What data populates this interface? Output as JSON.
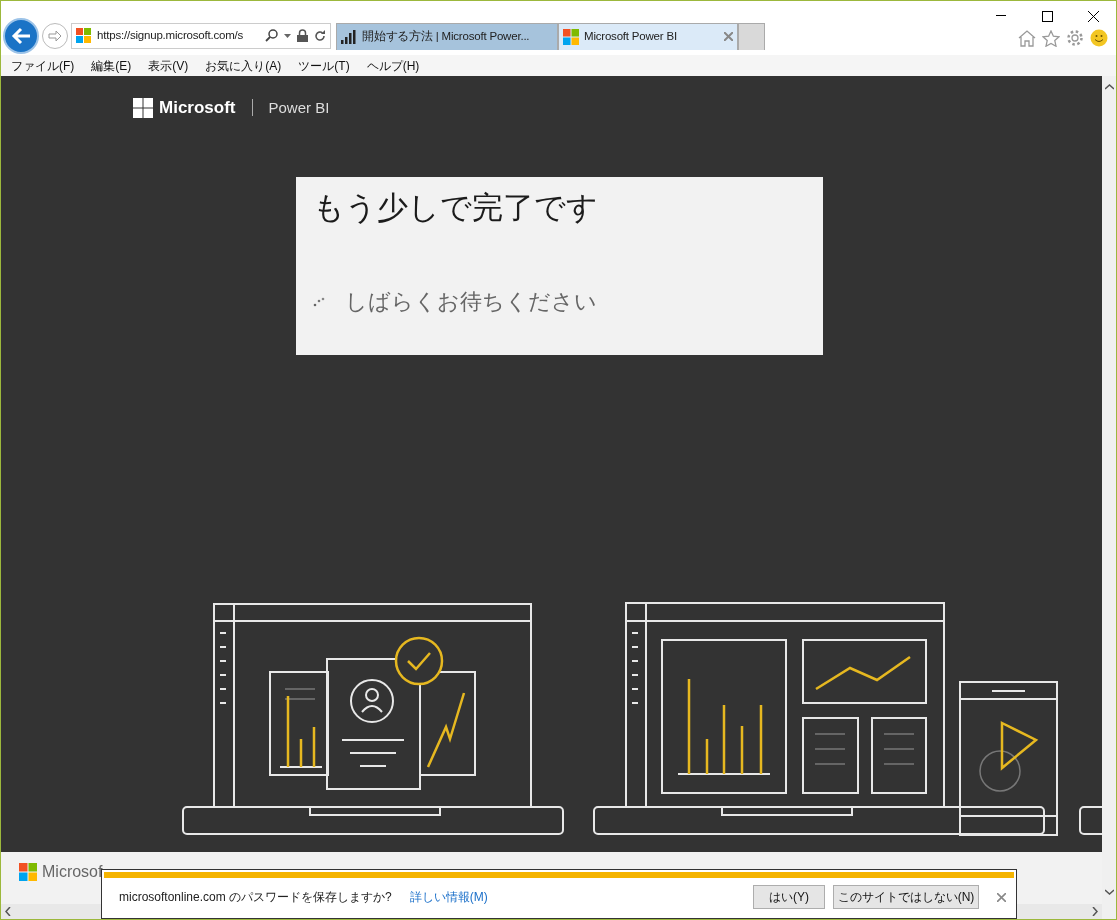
{
  "address_bar": {
    "url": "https://signup.microsoft.com/s"
  },
  "tabs": [
    {
      "label": "開始する方法 | Microsoft Power...",
      "selected": false
    },
    {
      "label": "Microsoft Power BI",
      "selected": true
    }
  ],
  "menu": [
    "ファイル(F)",
    "編集(E)",
    "表示(V)",
    "お気に入り(A)",
    "ツール(T)",
    "ヘルプ(H)"
  ],
  "header": {
    "brand": "Microsoft",
    "product": "Power BI"
  },
  "card": {
    "title": "もう少しで完了です",
    "status": "しばらくお待ちください"
  },
  "footer": {
    "brand": "Microsof"
  },
  "notification": {
    "message": "microsoftonline.com のパスワードを保存しますか?",
    "link": "詳しい情報(M)",
    "buttons": [
      "はい(Y)",
      "このサイトではしない(N)"
    ]
  }
}
